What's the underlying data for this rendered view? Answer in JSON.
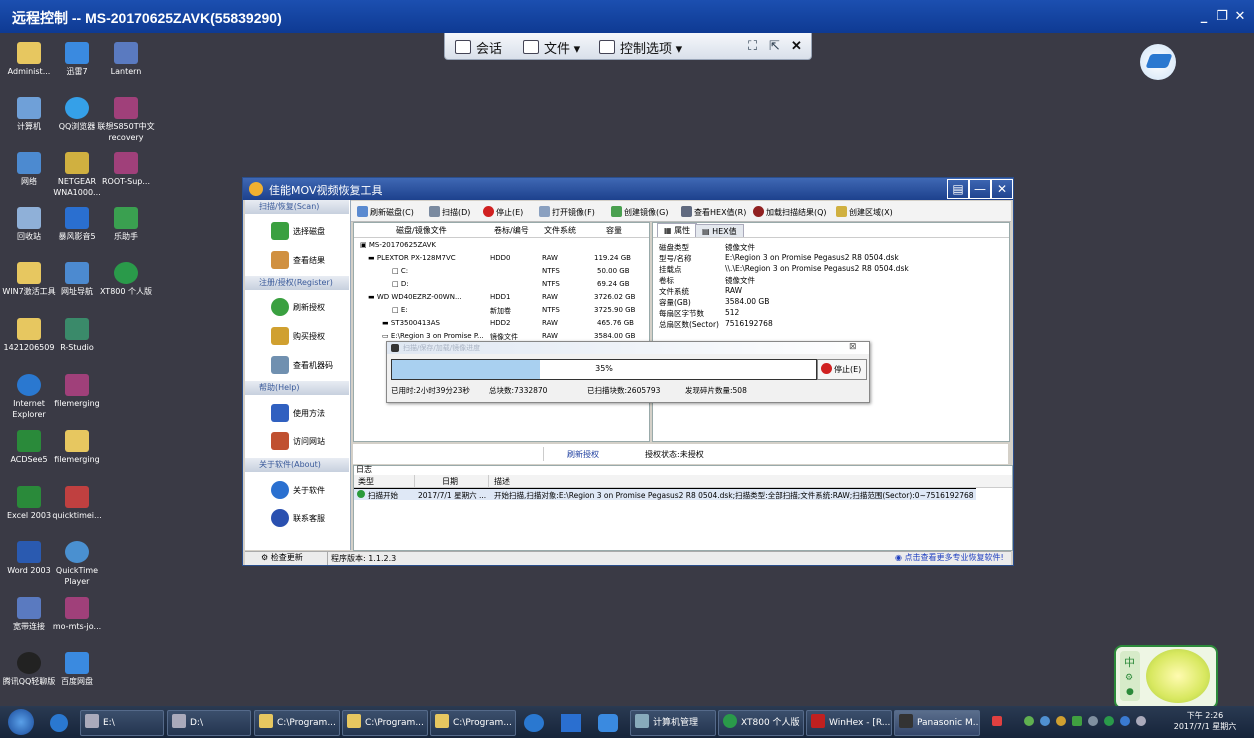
{
  "remote": {
    "title": "远程控制 -- MS-20170625ZAVK(55839290)",
    "toolbar": {
      "chat": "会话",
      "file": "文件",
      "control": "控制选项"
    }
  },
  "desktop_icons": [
    {
      "label": "Administ..."
    },
    {
      "label": "迅雷7"
    },
    {
      "label": "Lantern"
    },
    {
      "label": "计算机"
    },
    {
      "label": "QQ浏览器"
    },
    {
      "label": "联想S850T中文recovery"
    },
    {
      "label": "网络"
    },
    {
      "label": "NETGEAR WNA1000..."
    },
    {
      "label": "ROOT-Sup..."
    },
    {
      "label": "回收站"
    },
    {
      "label": "暴风影音5"
    },
    {
      "label": "乐助手"
    },
    {
      "label": "WIN7激活工具"
    },
    {
      "label": "网址导航"
    },
    {
      "label": "XT800 个人版"
    },
    {
      "label": "1421206509"
    },
    {
      "label": "R-Studio"
    },
    {
      "label": "Internet Explorer"
    },
    {
      "label": "filemerging"
    },
    {
      "label": "ACDSee5"
    },
    {
      "label": "filemerging"
    },
    {
      "label": "Excel 2003"
    },
    {
      "label": "quicktimei..."
    },
    {
      "label": "Word 2003"
    },
    {
      "label": "QuickTime Player"
    },
    {
      "label": "宽带连接"
    },
    {
      "label": "mo-mts-jo..."
    },
    {
      "label": "腾讯QQ轻聊版"
    },
    {
      "label": "百度网盘"
    }
  ],
  "app": {
    "title": "佳能MOV视频恢复工具",
    "left": {
      "sec1": "扫描/恢复(Scan)",
      "select_disk": "选择磁盘",
      "view_result": "查看结果",
      "sec2": "注册/授权(Register)",
      "refresh_auth": "刷新授权",
      "buy_auth": "购买授权",
      "view_code": "查看机器码",
      "sec3": "帮助(Help)",
      "howto": "使用方法",
      "visit": "访问网站",
      "sec4": "关于软件(About)",
      "about": "关于软件",
      "contact": "联系客服"
    },
    "toolbar": {
      "refresh": "刷新磁盘(C)",
      "scan": "扫描(D)",
      "stop": "停止(E)",
      "open_image": "打开镜像(F)",
      "create_image": "创建镜像(G)",
      "hex": "查看HEX值(R)",
      "load": "加载扫描结果(Q)",
      "region": "创建区域(X)"
    },
    "table": {
      "headers": [
        "磁盘/镜像文件",
        "卷标/编号",
        "文件系统",
        "容量"
      ],
      "rows": [
        {
          "name": "MS-20170625ZAVK",
          "label": "",
          "fs": "",
          "cap": ""
        },
        {
          "name": "PLEXTOR PX-128M7VC",
          "label": "HDD0",
          "fs": "RAW",
          "cap": "119.24 GB"
        },
        {
          "name": "C:",
          "label": "",
          "fs": "NTFS",
          "cap": "50.00 GB"
        },
        {
          "name": "D:",
          "label": "",
          "fs": "NTFS",
          "cap": "69.24 GB"
        },
        {
          "name": "WD    WD40EZRZ-00WN...",
          "label": "HDD1",
          "fs": "RAW",
          "cap": "3726.02 GB"
        },
        {
          "name": "E:",
          "label": "新加卷",
          "fs": "NTFS",
          "cap": "3725.90 GB"
        },
        {
          "name": "ST3500413AS",
          "label": "HDD2",
          "fs": "RAW",
          "cap": "465.76 GB"
        },
        {
          "name": "E:\\Region 3 on Promise P...",
          "label": "镜像文件",
          "fs": "RAW",
          "cap": "3584.00 GB"
        }
      ]
    },
    "props_tabs": {
      "attr": "属性",
      "hex": "HEX值"
    },
    "props": [
      {
        "k": "磁盘类型",
        "v": "镜像文件"
      },
      {
        "k": "型号/名称",
        "v": "E:\\Region 3 on Promise Pegasus2 R8 0504.dsk"
      },
      {
        "k": "挂载点",
        "v": "\\\\.\\E:\\Region 3 on Promise Pegasus2 R8 0504.dsk"
      },
      {
        "k": "卷标",
        "v": "镜像文件"
      },
      {
        "k": "文件系统",
        "v": "RAW"
      },
      {
        "k": "容量(GB)",
        "v": "3584.00 GB"
      },
      {
        "k": "每扇区字节数",
        "v": "512"
      },
      {
        "k": "总扇区数(Sector)",
        "v": "7516192768"
      }
    ],
    "dialog": {
      "title": "扫描/保存/加载/镜像进度",
      "percent_text": "35%",
      "percent": 35,
      "stop": "停止(E)",
      "elapsed": "已用时:2小时39分23秒",
      "total": "总块数:7332870",
      "scanned": "已扫描块数:2605793",
      "fragments": "发现碎片数量:508"
    },
    "midbar": {
      "refresh": "刷新授权",
      "status": "授权状态:未授权"
    },
    "log": {
      "label": "日志",
      "headers": [
        "类型",
        "日期",
        "描述"
      ],
      "row": {
        "type": "扫描开始",
        "date": "2017/7/1 星期六 ...",
        "desc": "开始扫描,扫描对象:E:\\Region 3 on Promise Pegasus2 R8 0504.dsk;扫描类型:全部扫描;文件系统:RAW;扫描范围(Sector):0~7516192768"
      }
    },
    "status": {
      "update": "检查更新",
      "version": "程序版本: 1.1.2.3",
      "promo": "点击查看更多专业恢复软件!"
    }
  },
  "widget": {
    "lang": "中"
  },
  "taskbar": {
    "items": [
      "E:\\",
      "D:\\",
      "C:\\Program...",
      "C:\\Program...",
      "C:\\Program...",
      "计算机管理",
      "XT800 个人版",
      "WinHex - [R...",
      "Panasonic M..."
    ],
    "time": "下午 2:26",
    "date": "2017/7/1 星期六"
  },
  "colors": {
    "title_bar": "#1c4fb0",
    "desktop": "#3a3a45",
    "progress": "#a9d0f0",
    "accent_green": "#2c8a3a"
  }
}
